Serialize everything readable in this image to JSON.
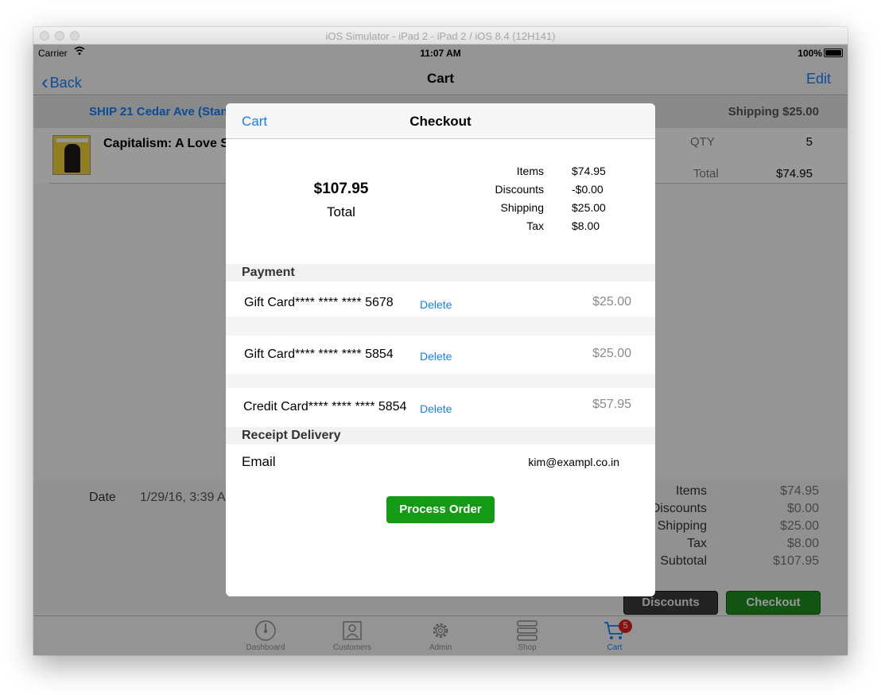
{
  "window": {
    "title": "iOS Simulator - iPad 2 - iPad 2 / iOS 8.4 (12H141)"
  },
  "status_bar": {
    "carrier": "Carrier",
    "time": "11:07 AM",
    "battery": "100%"
  },
  "nav": {
    "back": "Back",
    "title": "Cart",
    "edit": "Edit"
  },
  "shipping_bar": {
    "address": "SHIP 21 Cedar Ave (Stan",
    "shipping": "Shipping $25.00"
  },
  "item": {
    "name": "Capitalism: A Love S",
    "qty_label": "QTY",
    "qty": "5",
    "total_label": "Total",
    "total": "$74.95"
  },
  "order_summary": {
    "date_label": "Date",
    "date_value": "1/29/16, 3:39 A",
    "rows": [
      {
        "label": "Items",
        "value": "$74.95"
      },
      {
        "label": "Discounts",
        "value": "$0.00"
      },
      {
        "label": "Shipping",
        "value": "$25.00"
      },
      {
        "label": "Tax",
        "value": "$8.00"
      },
      {
        "label": "Subtotal",
        "value": "$107.95"
      }
    ]
  },
  "buttons": {
    "discounts": "Discounts",
    "checkout": "Checkout"
  },
  "tabbar": {
    "tabs": [
      {
        "label": "Dashboard",
        "icon": "dashboard-icon"
      },
      {
        "label": "Customers",
        "icon": "customers-icon"
      },
      {
        "label": "Admin",
        "icon": "gear-icon"
      },
      {
        "label": "Shop",
        "icon": "shop-icon"
      },
      {
        "label": "Cart",
        "icon": "cart-icon",
        "badge": "5"
      }
    ]
  },
  "modal": {
    "back": "Cart",
    "title": "Checkout",
    "total_value": "$107.95",
    "total_label": "Total",
    "breakdown": [
      {
        "label": "Items",
        "value": "$74.95"
      },
      {
        "label": "Discounts",
        "value": "-$0.00"
      },
      {
        "label": "Shipping",
        "value": "$25.00"
      },
      {
        "label": "Tax",
        "value": "$8.00"
      }
    ],
    "payment_header": "Payment",
    "payments": [
      {
        "label": "Gift Card**** **** **** 5678",
        "delete": "Delete",
        "amount": "$25.00"
      },
      {
        "label": "Gift Card**** **** **** 5854",
        "delete": "Delete",
        "amount": "$25.00"
      },
      {
        "label": "Credit Card**** **** **** 5854",
        "delete": "Delete",
        "amount": "$57.95"
      }
    ],
    "receipt_header": "Receipt Delivery",
    "email_label": "Email",
    "email_value": "kim@exampl.co.in",
    "process_button": "Process Order"
  },
  "colors": {
    "ios_blue": "#147efb",
    "green": "#159a15",
    "badge_red": "#e0201c"
  }
}
